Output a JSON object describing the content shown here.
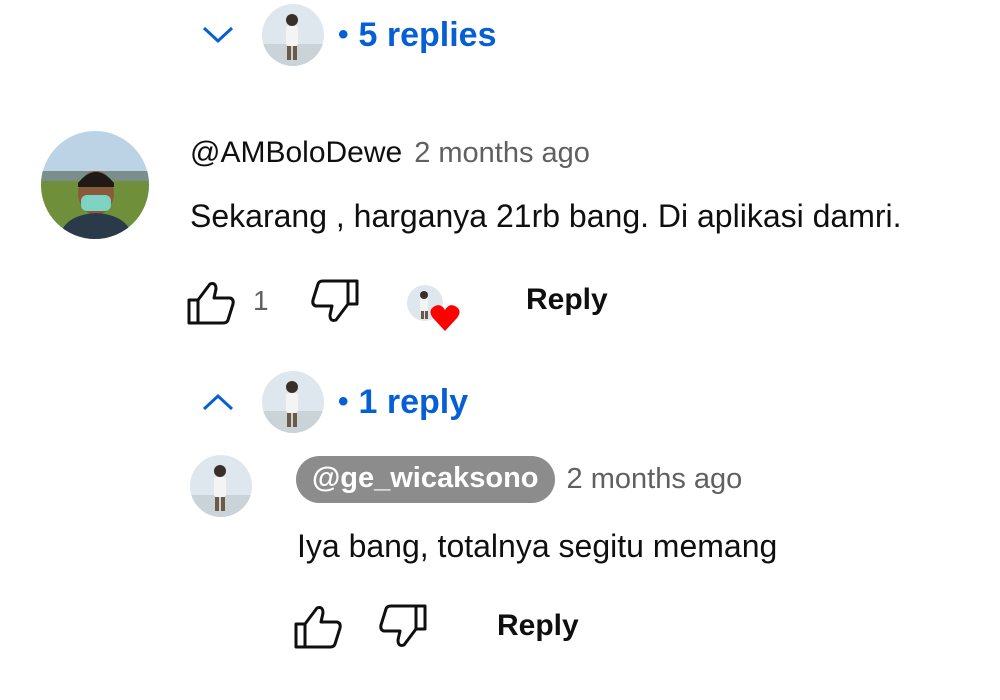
{
  "top_thread_toggle": {
    "chevron_icon": "chevron-down-icon",
    "count_label": "5 replies"
  },
  "comment": {
    "author": "@AMBoloDewe",
    "time": "2 months ago",
    "text": "Sekarang , harganya 21rb bang. Di aplikasi damri.",
    "like_count": "1",
    "reply_label": "Reply",
    "creator_heart": "heart-icon"
  },
  "reply_toggle": {
    "chevron_icon": "chevron-up-icon",
    "count_label": "1 reply"
  },
  "reply": {
    "mention": "@ge_wicaksono",
    "time": "2 months ago",
    "text": "Iya bang, totalnya segitu memang",
    "reply_label": "Reply"
  },
  "colors": {
    "link_blue": "#065fd4",
    "meta_gray": "#606060",
    "heart_red": "#ff0000",
    "mention_bg": "#8c8c8c"
  }
}
